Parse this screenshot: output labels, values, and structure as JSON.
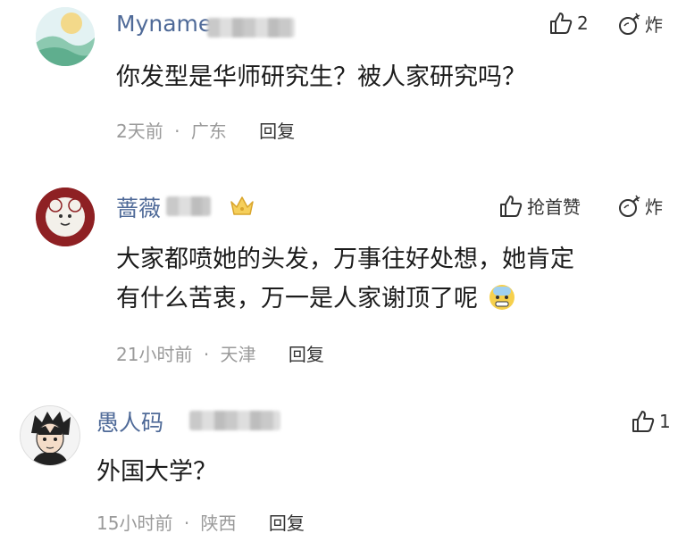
{
  "comments": [
    {
      "name": "Myname",
      "text": "你发型是华师研究生？被人家研究吗？",
      "time": "2天前",
      "location": "广东",
      "reply_label": "回复",
      "like_count": "2",
      "burn_label": "炸"
    },
    {
      "name": "蔷薇",
      "text_line1": "大家都喷她的头发，万事往好处想，她肯定",
      "text_line2": "有什么苦衷，万一是人家谢顶了呢",
      "time": "21小时前",
      "location": "天津",
      "reply_label": "回复",
      "like_label": "抢首赞",
      "burn_label": "炸"
    },
    {
      "name": "愚人码",
      "text": "外国大学？",
      "time": "15小时前",
      "location": "陕西",
      "reply_label": "回复",
      "like_count": "1"
    }
  ],
  "meta_separator": "·",
  "icons": {
    "like": "thumbs-up-icon",
    "burn": "bomb-icon",
    "crown": "crown-badge-icon",
    "emoji": "cold-sweat-emoji-icon"
  },
  "colors": {
    "name": "#4f6a98",
    "meta": "#9a9a9a"
  }
}
